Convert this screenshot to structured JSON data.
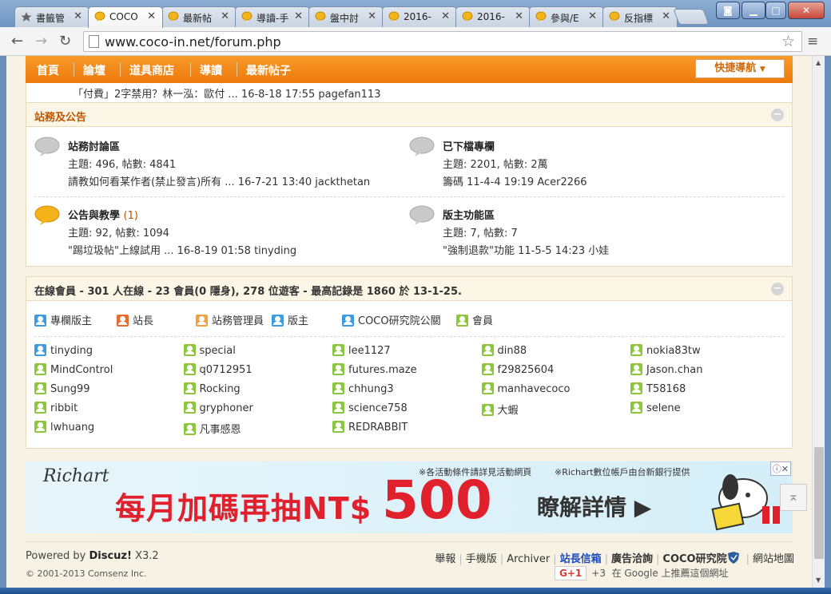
{
  "browser": {
    "tabs": [
      {
        "label": "書籤管",
        "icon": "star-icon",
        "active": false
      },
      {
        "label": "COCO",
        "icon": "coco-icon",
        "active": true
      },
      {
        "label": "最新帖",
        "icon": "coco-icon",
        "active": false
      },
      {
        "label": "導讀-手",
        "icon": "coco-icon",
        "active": false
      },
      {
        "label": "盤中討",
        "icon": "coco-icon",
        "active": false
      },
      {
        "label": "2016-",
        "icon": "coco-icon",
        "active": false
      },
      {
        "label": "2016-",
        "icon": "coco-icon",
        "active": false
      },
      {
        "label": "參與/E",
        "icon": "coco-icon",
        "active": false
      },
      {
        "label": "反指標",
        "icon": "coco-icon",
        "active": false
      }
    ],
    "url": "www.coco-in.net/forum.php"
  },
  "forum_nav": {
    "items": [
      "首頁",
      "論壇",
      "道具商店",
      "導讀",
      "最新帖子"
    ],
    "quick_nav": "快捷導航"
  },
  "prev_row": "「付費」2字禁用？林一泓：歐付 ... 16-8-18 17:55 pagefan113",
  "announce": {
    "title": "站務及公告",
    "forums": [
      {
        "name": "站務討論區",
        "today": "",
        "stats": "主題: 496, 帖數: 4841",
        "last": "請教如何看某作者(禁止發言)所有 ... 16-7-21 13:40 jackthetan",
        "new": false
      },
      {
        "name": "已下檔專欄",
        "today": "",
        "stats": "主題: 2201, 帖數: 2萬",
        "last": "籌碼 11-4-4 19:19 Acer2266",
        "new": false
      },
      {
        "name": "公告與教學",
        "today": "(1)",
        "stats": "主題: 92, 帖數: 1094",
        "last": "\"踢垃圾帖\"上線試用 ... 16-8-19 01:58 tinyding",
        "new": true
      },
      {
        "name": "版主功能區",
        "today": "",
        "stats": "主題: 7, 帖數: 7",
        "last": "\"強制退款\"功能 11-5-5 14:23 小娃",
        "new": false
      }
    ]
  },
  "online": {
    "title_prefix": "在線會員",
    "title_stats": " - 301 人在線 - 23 會員(0 隱身), 278 位遊客 - 最高記錄是 1860 於 13-1-25.",
    "legend": [
      {
        "label": "專欄版主",
        "color": "#3d9be0"
      },
      {
        "label": "站長",
        "color": "#e86a2c"
      },
      {
        "label": "站務管理員",
        "color": "#f0a040"
      },
      {
        "label": "版主",
        "color": "#3d9be0"
      },
      {
        "label": "COCO研究院公關",
        "color": "#3d9be0"
      },
      {
        "label": "會員",
        "color": "#8cc63e"
      }
    ],
    "members": [
      {
        "name": "tinyding",
        "color": "#3d9be0"
      },
      {
        "name": "special",
        "color": "#8cc63e"
      },
      {
        "name": "lee1127",
        "color": "#8cc63e"
      },
      {
        "name": "din88",
        "color": "#8cc63e"
      },
      {
        "name": "nokia83tw",
        "color": "#8cc63e"
      },
      {
        "name": "MindControl",
        "color": "#8cc63e"
      },
      {
        "name": "q0712951",
        "color": "#8cc63e"
      },
      {
        "name": "futures.maze",
        "color": "#8cc63e"
      },
      {
        "name": "f29825604",
        "color": "#8cc63e"
      },
      {
        "name": "Jason.chan",
        "color": "#8cc63e"
      },
      {
        "name": "Sung99",
        "color": "#8cc63e"
      },
      {
        "name": "Rocking",
        "color": "#8cc63e"
      },
      {
        "name": "chhung3",
        "color": "#8cc63e"
      },
      {
        "name": "manhavecoco",
        "color": "#8cc63e"
      },
      {
        "name": "T58168",
        "color": "#8cc63e"
      },
      {
        "name": "ribbit",
        "color": "#8cc63e"
      },
      {
        "name": "gryphoner",
        "color": "#8cc63e"
      },
      {
        "name": "science758",
        "color": "#8cc63e"
      },
      {
        "name": "大蝦",
        "color": "#8cc63e"
      },
      {
        "name": "selene",
        "color": "#8cc63e"
      },
      {
        "name": "lwhuang",
        "color": "#8cc63e"
      },
      {
        "name": "凡事感恩",
        "color": "#8cc63e"
      },
      {
        "name": "REDRABBIT",
        "color": "#8cc63e"
      }
    ]
  },
  "ad": {
    "logo": "Richart",
    "note1": "※各活動條件請詳見活動網頁",
    "note2": "※Richart數位帳戶由台新銀行提供",
    "headline": "每月加碼再抽NT$",
    "amount": "500",
    "cta": "瞭解詳情 ▶"
  },
  "footer": {
    "powered_prefix": "Powered by ",
    "powered_brand": "Discuz!",
    "powered_version": " X3.2",
    "copyright": "© 2001-2013 Comsenz Inc.",
    "links": [
      {
        "label": "舉報",
        "style": ""
      },
      {
        "label": "手機版",
        "style": ""
      },
      {
        "label": "Archiver",
        "style": ""
      },
      {
        "label": "站長信箱",
        "style": "blue"
      },
      {
        "label": "廣告洽詢",
        "style": "bold"
      },
      {
        "label": "COCO研究院",
        "style": "bold"
      },
      {
        "label": "網站地圖",
        "style": ""
      }
    ],
    "gplus_label": "G+1",
    "gplus_count": "+3",
    "gplus_text": "在 Google 上推薦這個網址"
  },
  "colors": {
    "accent": "#ec7a0c",
    "heading": "#c05400",
    "online_bold": "#1a4cc0"
  }
}
